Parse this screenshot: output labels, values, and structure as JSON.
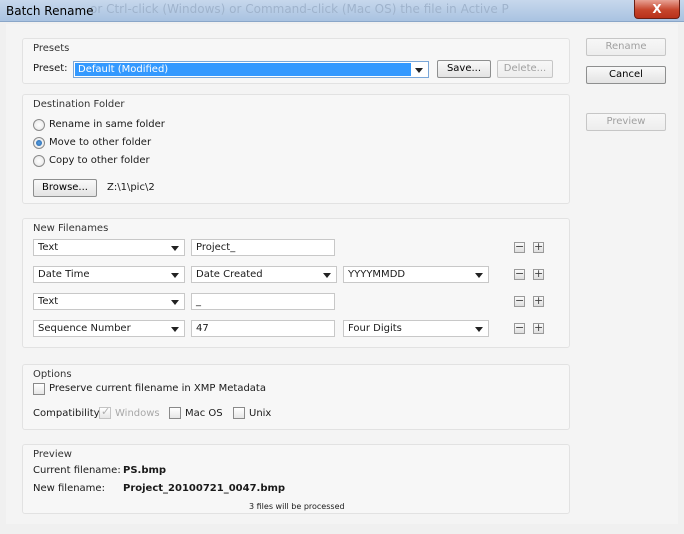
{
  "window": {
    "title": "Batch Rename",
    "background_text": "or Ctrl-click (Windows) or Command-click (Mac OS) the file in Active P",
    "close_glyph": "X"
  },
  "side_buttons": {
    "rename": "Rename",
    "cancel": "Cancel",
    "preview": "Preview"
  },
  "presets": {
    "group_title": "Presets",
    "label": "Preset:",
    "selected": "Default (Modified)",
    "save_label": "Save...",
    "delete_label": "Delete..."
  },
  "destination": {
    "group_title": "Destination Folder",
    "options": [
      "Rename in same folder",
      "Move to other folder",
      "Copy to other folder"
    ],
    "selected_index": 1,
    "browse_label": "Browse...",
    "path": "Z:\\1\\pic\\2"
  },
  "new_filenames": {
    "group_title": "New Filenames",
    "rows": [
      {
        "type": "Text",
        "value": "Project_",
        "value_is_select": false,
        "format": ""
      },
      {
        "type": "Date Time",
        "value": "Date Created",
        "value_is_select": true,
        "format": "YYYYMMDD"
      },
      {
        "type": "Text",
        "value": "_",
        "value_is_select": false,
        "format": ""
      },
      {
        "type": "Sequence Number",
        "value": "47",
        "value_is_select": false,
        "format": "Four Digits"
      }
    ],
    "minus_glyph": "−",
    "plus_glyph": "+"
  },
  "options": {
    "group_title": "Options",
    "preserve_label": "Preserve current filename in XMP Metadata",
    "preserve_checked": false,
    "compat_label": "Compatibility:",
    "windows_label": "Windows",
    "windows_checked": true,
    "macos_label": "Mac OS",
    "macos_checked": false,
    "unix_label": "Unix",
    "unix_checked": false,
    "tick_glyph": "✓"
  },
  "preview": {
    "group_title": "Preview",
    "current_label": "Current filename:",
    "current_value": "PS.bmp",
    "new_label": "New filename:",
    "new_value": "Project_20100721_0047.bmp",
    "files_note": "3 files will be processed"
  },
  "colors": {
    "selection_blue": "#3399ff",
    "close_red": "#c6452c"
  }
}
